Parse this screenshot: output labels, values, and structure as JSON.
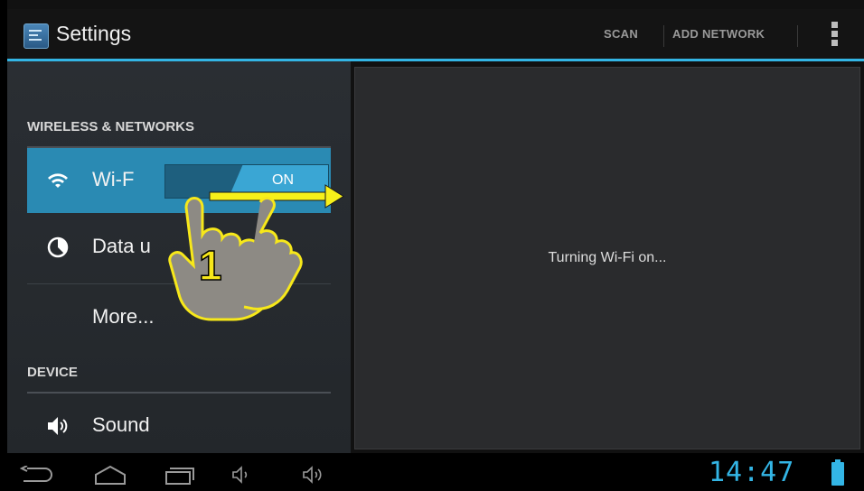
{
  "actionbar": {
    "title": "Settings",
    "scan_label": "SCAN",
    "add_network_label": "ADD NETWORK"
  },
  "sections": {
    "wireless_header": "WIRELESS & NETWORKS",
    "device_header": "DEVICE"
  },
  "items": {
    "wifi": {
      "label": "Wi-F",
      "toggle": "ON"
    },
    "data_usage": {
      "label": "Data u"
    },
    "more": {
      "label": "More..."
    },
    "sound": {
      "label": "Sound"
    }
  },
  "main": {
    "status": "Turning Wi-Fi on..."
  },
  "overlay": {
    "step_number": "1"
  },
  "navbar": {
    "clock": "14:47"
  },
  "colors": {
    "accent": "#33b5e5",
    "selected": "#2a8ab3",
    "arrow": "#f7f01a"
  }
}
